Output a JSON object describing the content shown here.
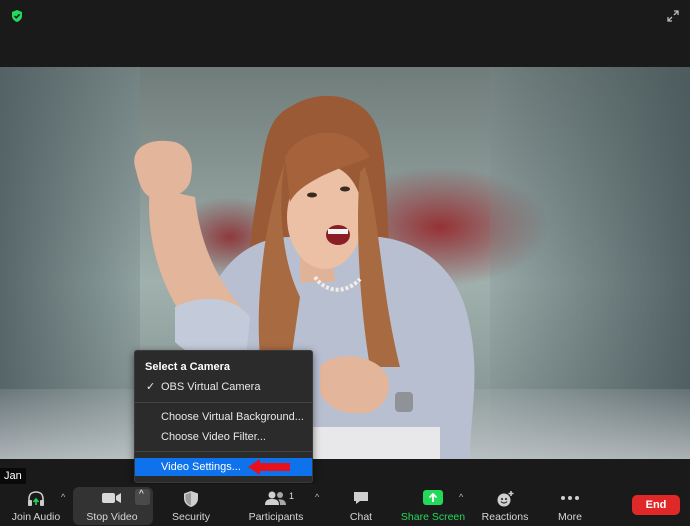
{
  "top": {
    "security_shield_color": "#23d959"
  },
  "video": {
    "participant_name": "Jan"
  },
  "camera_menu": {
    "header": "Select a Camera",
    "cameras": [
      {
        "label": "OBS Virtual Camera",
        "checked": true
      }
    ],
    "options": [
      "Choose Virtual Background...",
      "Choose Video Filter..."
    ],
    "settings": "Video Settings..."
  },
  "toolbar": {
    "join_audio": "Join Audio",
    "stop_video": "Stop Video",
    "security": "Security",
    "participants": "Participants",
    "participants_count": "1",
    "chat": "Chat",
    "share_screen": "Share Screen",
    "reactions": "Reactions",
    "more": "More",
    "end": "End"
  },
  "colors": {
    "accent": "#0e72ed",
    "share_green": "#23d959",
    "end_red": "#e02828",
    "arrow_red": "#e8101a"
  }
}
